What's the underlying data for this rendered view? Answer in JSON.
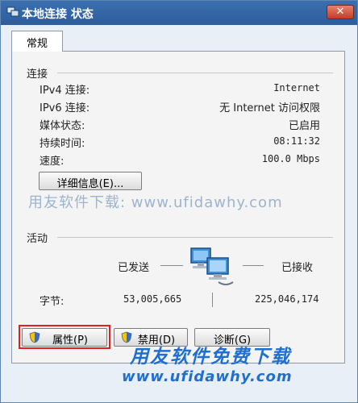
{
  "window": {
    "title": "本地连接 状态",
    "close_label": "✕"
  },
  "tab": {
    "label": "常规"
  },
  "connection": {
    "section": "连接",
    "ipv4_label": "IPv4 连接:",
    "ipv4_value": "Internet",
    "ipv6_label": "IPv6 连接:",
    "ipv6_value": "无 Internet 访问权限",
    "media_label": "媒体状态:",
    "media_value": "已启用",
    "duration_label": "持续时间:",
    "duration_value": "08:11:32",
    "speed_label": "速度:",
    "speed_value": "100.0 Mbps",
    "details_button": "详细信息(E)..."
  },
  "activity": {
    "section": "活动",
    "sent_label": "已发送",
    "received_label": "已接收",
    "bytes_label": "字节:",
    "bytes_sent": "53,005,665",
    "bytes_received": "225,046,174"
  },
  "buttons": {
    "properties": "属性(P)",
    "disable": "禁用(D)",
    "diagnose": "诊断(G)"
  },
  "watermarks": {
    "mid": "用友软件下载: www.ufidawhy.com",
    "bottom_cn": "用友软件免费下载",
    "bottom_url": "www.ufidawhy.com"
  },
  "icons": {
    "title": "network-connection-icon",
    "shield": "uac-shield-icon",
    "network": "network-computers-icon"
  },
  "colors": {
    "titlebar": "#2d5d9b",
    "highlight": "#e02020",
    "watermark": "#1f6fd1"
  }
}
